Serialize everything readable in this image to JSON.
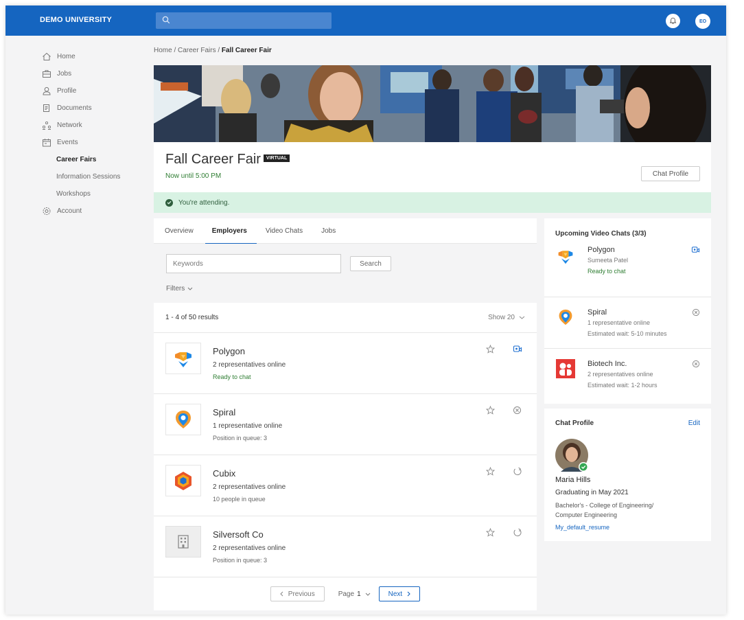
{
  "topbar": {
    "brand": "DEMO UNIVERSITY",
    "user_initials": "EO",
    "bell_icon": "bell-icon",
    "search_icon": "search-icon"
  },
  "sidebar": {
    "items": [
      {
        "label": "Home",
        "icon": "home-icon"
      },
      {
        "label": "Jobs",
        "icon": "briefcase-icon"
      },
      {
        "label": "Profile",
        "icon": "person-icon"
      },
      {
        "label": "Documents",
        "icon": "documents-icon"
      },
      {
        "label": "Network",
        "icon": "network-icon"
      },
      {
        "label": "Events",
        "icon": "calendar-icon"
      }
    ],
    "sub_items": [
      {
        "label": "Career Fairs",
        "active": true
      },
      {
        "label": "Information Sessions",
        "active": false
      },
      {
        "label": "Workshops",
        "active": false
      }
    ],
    "account": {
      "label": "Account",
      "icon": "gear-icon"
    }
  },
  "breadcrumb": {
    "path": "Home / Career Fairs / ",
    "current": "Fall Career Fair"
  },
  "event": {
    "title": "Fall Career Fair",
    "badge": "VIRTUAL",
    "time": "Now until 5:00 PM",
    "chat_profile_button": "Chat Profile",
    "attending_text": "You're attending."
  },
  "tabs": [
    {
      "label": "Overview",
      "active": false
    },
    {
      "label": "Employers",
      "active": true
    },
    {
      "label": "Video Chats",
      "active": false
    },
    {
      "label": "Jobs",
      "active": false
    }
  ],
  "filters": {
    "keywords_placeholder": "Keywords",
    "search_button": "Search",
    "filters_label": "Filters"
  },
  "results": {
    "summary": "1 - 4 of 50 results",
    "show": "Show 20"
  },
  "employers": [
    {
      "name": "Polygon",
      "reps": "2 representatives online",
      "status": "Ready to chat",
      "status_green": true,
      "action_icon": "video-chat-icon"
    },
    {
      "name": "Spiral",
      "reps": "1 representative online",
      "status": "Position in queue: 3",
      "status_green": false,
      "action_icon": "cancel-icon"
    },
    {
      "name": "Cubix",
      "reps": "2 representatives online",
      "status": "10 people in queue",
      "status_green": false,
      "action_icon": "join-queue-icon"
    },
    {
      "name": "Silversoft Co",
      "reps": "2 representatives online",
      "status": "Position in queue: 3",
      "status_green": false,
      "action_icon": "join-queue-icon"
    }
  ],
  "pagination": {
    "previous": "Previous",
    "page_label": "Page",
    "page_value": "1",
    "next": "Next"
  },
  "upcoming": {
    "title": "Upcoming Video Chats (3/3)",
    "chats": [
      {
        "name": "Polygon",
        "line2": "Sumeeta Patel",
        "line3": "Ready to chat",
        "line3_green": true,
        "icon": "video-chat-icon"
      },
      {
        "name": "Spiral",
        "line2": "1 representative online",
        "line3": "Estimated wait: 5-10 minutes",
        "line3_green": false,
        "icon": "cancel-icon"
      },
      {
        "name": "Biotech Inc.",
        "line2": "2 representatives online",
        "line3": "Estimated wait: 1-2 hours",
        "line3_green": false,
        "icon": "cancel-icon"
      }
    ]
  },
  "chat_profile": {
    "title": "Chat Profile",
    "edit": "Edit",
    "name": "Maria Hills",
    "graduating": "Graduating in May 2021",
    "degree_line1": "Bachelor's - College of Engineering/",
    "degree_line2": "Computer Engineering",
    "resume": "My_default_resume"
  },
  "colors": {
    "brand_blue": "#1565c0",
    "success_green": "#2e7d32",
    "attending_bg": "#d8f2e3"
  }
}
